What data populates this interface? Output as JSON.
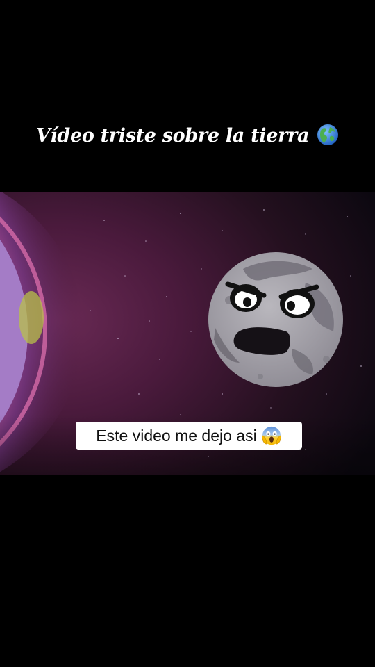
{
  "overlay": {
    "title": "Vídeo triste sobre la tierra",
    "title_emoji": "globe-americas-icon",
    "caption": "Este video me dejo asi",
    "caption_emoji": "face-screaming-in-fear-icon"
  },
  "colors": {
    "background": "#000000",
    "space_purple": "#2a0f24",
    "earth_glow": "#9b6fc1",
    "moon_gray": "#a8a6ad"
  }
}
